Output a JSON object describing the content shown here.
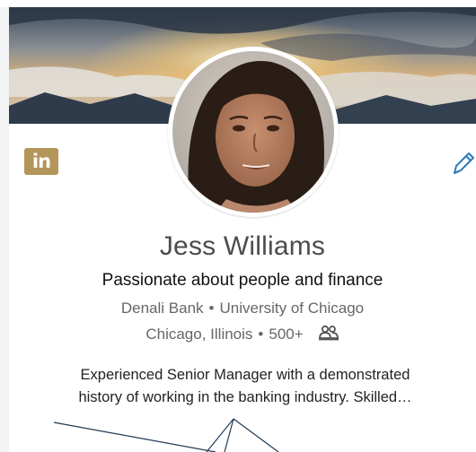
{
  "profile": {
    "name": "Jess Williams",
    "headline": "Passionate about people and finance",
    "company": "Denali Bank",
    "school": "University of Chicago",
    "location": "Chicago, Illinois",
    "connections": "500+",
    "summary_line1": "Experienced Senior Manager with a demonstrated",
    "summary_line2": "history of working in the banking industry. Skilled…",
    "separator": "•"
  },
  "brand": {
    "logo_text": "in",
    "logo_color": "#b4955a"
  },
  "icons": {
    "edit": "pencil-icon",
    "connections": "people-icon",
    "logo": "linkedin-logo"
  },
  "colors": {
    "accent": "#2d7ab6",
    "text": "#4c4c4c",
    "muted": "#666666"
  }
}
